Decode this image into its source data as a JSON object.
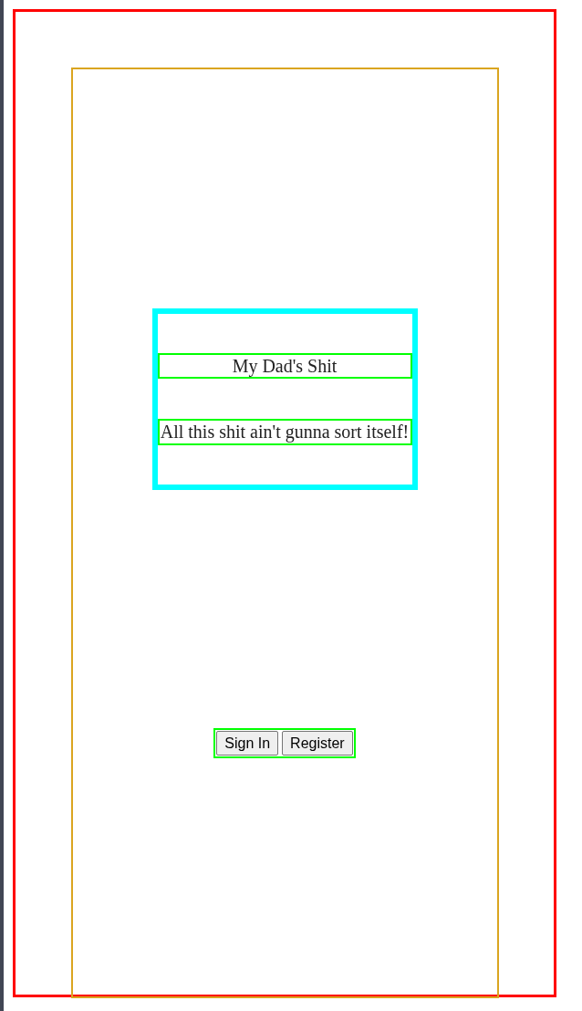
{
  "header": {
    "title": "My Dad's Shit",
    "tagline": "All this shit ain't gunna sort itself!"
  },
  "buttons": [
    {
      "label": "Sign In"
    },
    {
      "label": "Register"
    }
  ]
}
